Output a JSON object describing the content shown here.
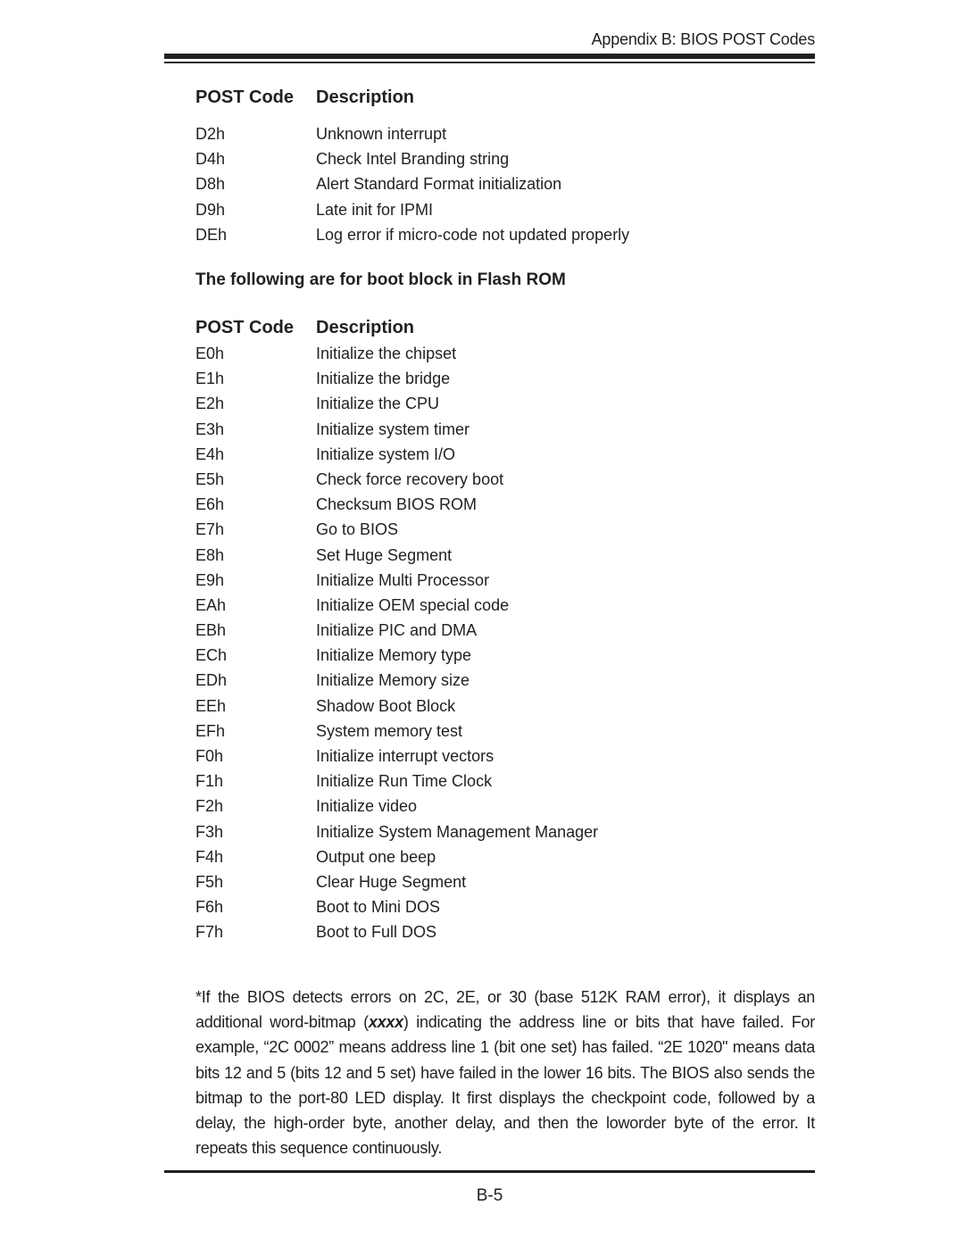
{
  "running_head": "Appendix B: BIOS POST Codes",
  "table1": {
    "headers": {
      "code": "POST Code",
      "description": "Description"
    },
    "rows": [
      {
        "code": "D2h",
        "description": "Unknown interrupt"
      },
      {
        "code": "D4h",
        "description": "Check Intel Branding string"
      },
      {
        "code": "D8h",
        "description": "Alert Standard Format  initialization"
      },
      {
        "code": "D9h",
        "description": "Late init for IPMI"
      },
      {
        "code": "DEh",
        "description": "Log error if micro-code not updated properly"
      }
    ]
  },
  "section_title": "The following are for boot block in Flash ROM",
  "table2": {
    "headers": {
      "code": "POST Code",
      "description": "Description"
    },
    "rows": [
      {
        "code": "E0h",
        "description": "Initialize the chipset"
      },
      {
        "code": "E1h",
        "description": "Initialize the bridge"
      },
      {
        "code": "E2h",
        "description": "Initialize the CPU"
      },
      {
        "code": "E3h",
        "description": "Initialize system timer"
      },
      {
        "code": "E4h",
        "description": "Initialize system I/O"
      },
      {
        "code": "E5h",
        "description": "Check force recovery boot"
      },
      {
        "code": "E6h",
        "description": "Checksum BIOS ROM"
      },
      {
        "code": "E7h",
        "description": "Go to BIOS"
      },
      {
        "code": "E8h",
        "description": "Set Huge Segment"
      },
      {
        "code": "E9h",
        "description": "Initialize Multi Processor"
      },
      {
        "code": "EAh",
        "description": "Initialize OEM special code"
      },
      {
        "code": "EBh",
        "description": "Initialize PIC and DMA"
      },
      {
        "code": "ECh",
        "description": "Initialize Memory type"
      },
      {
        "code": "EDh",
        "description": "Initialize Memory size"
      },
      {
        "code": "EEh",
        "description": "Shadow Boot Block"
      },
      {
        "code": "EFh",
        "description": "System memory test"
      },
      {
        "code": "F0h",
        "description": "Initialize interrupt vectors"
      },
      {
        "code": "F1h",
        "description": "Initialize Run Time Clock"
      },
      {
        "code": "F2h",
        "description": "Initialize video"
      },
      {
        "code": "F3h",
        "description": "Initialize System Management Manager"
      },
      {
        "code": "F4h",
        "description": "Output one beep"
      },
      {
        "code": "F5h",
        "description": "Clear Huge Segment"
      },
      {
        "code": "F6h",
        "description": "Boot to Mini DOS"
      },
      {
        "code": "F7h",
        "description": "Boot to Full DOS"
      }
    ]
  },
  "footnote": {
    "before": "*If the BIOS detects errors on 2C, 2E, or 30 (base 512K RAM error), it displays an additional word-bitmap (",
    "emphasis": "xxxx",
    "after": ") indicating the address line or bits that have failed.  For example, “2C 0002” means address line 1 (bit one set) has failed.  “2E 1020\" means data bits 12 and 5 (bits 12 and 5 set) have failed in the lower 16 bits. The BIOS also sends the bitmap to the port-80 LED display.  It first displays the checkpoint code, followed by a delay, the high-order byte, another delay, and then the loworder byte of the error.  It repeats this sequence continuously."
  },
  "page_number": "B-5"
}
